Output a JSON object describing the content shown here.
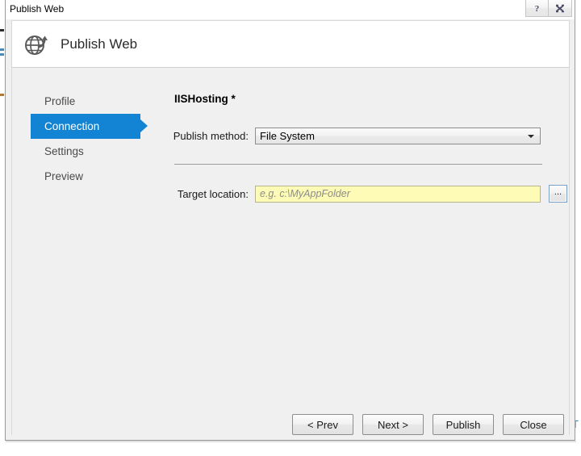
{
  "window": {
    "title": "Publish Web",
    "help_button_label": "?",
    "close_button_label": "Close",
    "accent_color": "#1284d3",
    "body_background": "#f0f0f0",
    "input_highlight_color": "#fdfbb6"
  },
  "header": {
    "title": "Publish Web",
    "icon": "globe-publish-icon"
  },
  "sidebar": {
    "items": [
      {
        "label": "Profile",
        "selected": false
      },
      {
        "label": "Connection",
        "selected": true
      },
      {
        "label": "Settings",
        "selected": false
      },
      {
        "label": "Preview",
        "selected": false
      }
    ]
  },
  "main": {
    "heading": "IISHosting *",
    "publish_method": {
      "label": "Publish method:",
      "value": "File System",
      "options": [
        "File System"
      ]
    },
    "target_location": {
      "label": "Target location:",
      "value": "",
      "placeholder": "e.g. c:\\MyAppFolder",
      "browse_label": "..."
    }
  },
  "footer": {
    "buttons": [
      {
        "label": "< Prev"
      },
      {
        "label": "Next >"
      },
      {
        "label": "Publish"
      },
      {
        "label": "Close"
      }
    ]
  }
}
